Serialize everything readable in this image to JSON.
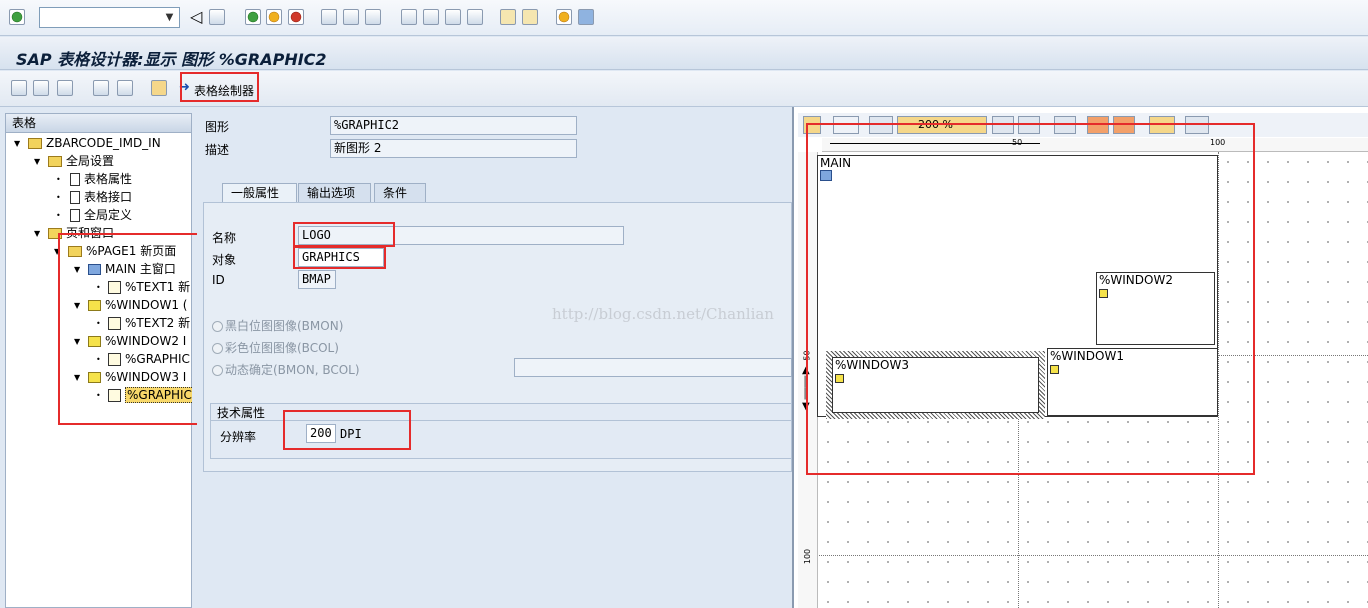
{
  "window": {
    "title": "SAP 表格设计器:显示 图形 %GRAPHIC2"
  },
  "system_toolbar": {
    "command_value": "",
    "icons": [
      "enter-icon",
      "save-icon",
      "back-icon",
      "exit-icon",
      "cancel-icon",
      "print-icon",
      "find-icon",
      "find-next-icon",
      "first-page-icon",
      "prev-page-icon",
      "next-page-icon",
      "last-page-icon",
      "new-session-icon",
      "shortcut-icon",
      "help-icon",
      "layout-icon"
    ]
  },
  "app_toolbar": {
    "form_painter_label": "表格绘制器"
  },
  "tree": {
    "header": "表格",
    "items": [
      {
        "label": "ZBARCODE_IMD_IN",
        "level": 0,
        "icon": "folder-icon",
        "toggle": "▼"
      },
      {
        "label": "全局设置",
        "level": 1,
        "icon": "folder-icon",
        "toggle": "▼"
      },
      {
        "label": "表格属性",
        "level": 2,
        "icon": "document-icon",
        "toggle": "•"
      },
      {
        "label": "表格接口",
        "level": 2,
        "icon": "document-icon",
        "toggle": "•"
      },
      {
        "label": "全局定义",
        "level": 2,
        "icon": "document-icon",
        "toggle": "•"
      },
      {
        "label": "页和窗口",
        "level": 1,
        "icon": "folder-icon",
        "toggle": "▼"
      },
      {
        "label": "%PAGE1 新页面",
        "level": 2,
        "icon": "folder-icon",
        "toggle": "▼"
      },
      {
        "label": "MAIN 主窗口",
        "level": 3,
        "icon": "main-window-icon",
        "toggle": "▼"
      },
      {
        "label": "%TEXT1 新",
        "level": 4,
        "icon": "text-icon",
        "toggle": "•"
      },
      {
        "label": "%WINDOW1 (",
        "level": 3,
        "icon": "window-icon",
        "toggle": "▼"
      },
      {
        "label": "%TEXT2 新",
        "level": 4,
        "icon": "text-icon",
        "toggle": "•"
      },
      {
        "label": "%WINDOW2 I",
        "level": 3,
        "icon": "window-icon",
        "toggle": "▼"
      },
      {
        "label": "%GRAPHIC",
        "level": 4,
        "icon": "graphic-icon",
        "toggle": "•"
      },
      {
        "label": "%WINDOW3 I",
        "level": 3,
        "icon": "window-icon",
        "toggle": "▼"
      },
      {
        "label": "%GRAPHIC",
        "level": 4,
        "icon": "graphic-icon",
        "toggle": "•",
        "selected": true
      }
    ]
  },
  "node": {
    "graphic_label": "图形",
    "graphic_value": "%GRAPHIC2",
    "desc_label": "描述",
    "desc_value": "新图形 2"
  },
  "tabs": [
    {
      "label": "一般属性",
      "active": true
    },
    {
      "label": "输出选项"
    },
    {
      "label": "条件"
    }
  ],
  "general": {
    "name_label": "名称",
    "name_value": "LOGO",
    "object_label": "对象",
    "object_value": "GRAPHICS",
    "id_label": "ID",
    "id_value": "BMAP",
    "radios": [
      "黑白位图图像(BMON)",
      "彩色位图图像(BCOL)",
      "动态确定(BMON, BCOL)"
    ],
    "tech_title": "技术属性",
    "resolution_label": "分辨率",
    "resolution_value": "200",
    "resolution_unit": "DPI"
  },
  "painter": {
    "zoom": "200 %",
    "ruler_marks": [
      "50",
      "100"
    ],
    "vruler_marks": [
      "50",
      "100"
    ],
    "windows": [
      "MAIN",
      "%WINDOW2",
      "%WINDOW1",
      "%WINDOW3"
    ]
  },
  "watermark": "http://blog.csdn.net/Chanlian"
}
